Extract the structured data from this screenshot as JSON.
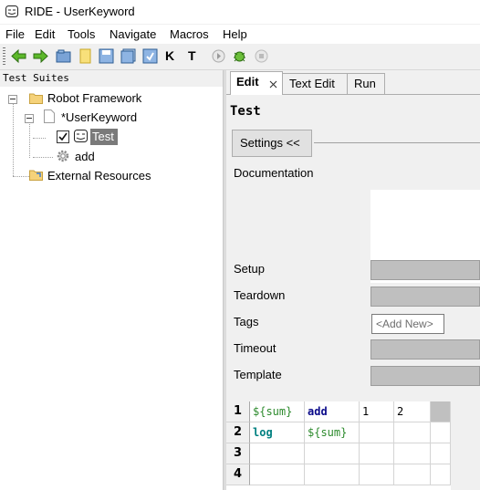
{
  "window": {
    "title": "RIDE - UserKeyword"
  },
  "menu": [
    "File",
    "Edit",
    "Tools",
    "Navigate",
    "Macros",
    "Help"
  ],
  "toolbar": {
    "icons": [
      "back-arrow-icon",
      "forward-arrow-icon",
      "open-folder-icon",
      "new-file-icon",
      "save-icon",
      "save-all-icon",
      "save-as-icon",
      "search-keywords-icon",
      "search-tests-icon",
      "run-icon",
      "debug-icon",
      "stop-icon"
    ],
    "labels": {
      "keyword_letter": "K",
      "test_letter": "T"
    }
  },
  "tree": {
    "header": "Test Suites",
    "nodes": {
      "root": "Robot Framework",
      "userkeyword": "*UserKeyword",
      "test": "Test",
      "add": "add",
      "external": "External Resources"
    }
  },
  "tabs": {
    "edit": "Edit",
    "text_edit": "Text Edit",
    "run": "Run"
  },
  "editor": {
    "heading": "Test",
    "settings_button": "Settings <<",
    "labels": {
      "documentation": "Documentation",
      "setup": "Setup",
      "teardown": "Teardown",
      "tags": "Tags",
      "timeout": "Timeout",
      "template": "Template"
    },
    "tags_placeholder": "<Add New>"
  },
  "grid": {
    "rows": [
      {
        "num": "1",
        "cells": [
          "${sum}",
          "add",
          "1",
          "2"
        ]
      },
      {
        "num": "2",
        "cells": [
          "log",
          "${sum}",
          "",
          ""
        ]
      },
      {
        "num": "3",
        "cells": [
          "",
          "",
          "",
          ""
        ]
      },
      {
        "num": "4",
        "cells": [
          "",
          "",
          "",
          ""
        ]
      }
    ]
  },
  "colors": {
    "selection": "#7a7a7a",
    "field_gray": "#bfbfbf",
    "variable": "#2c8a2c",
    "keyword": "#0a0a8a"
  }
}
